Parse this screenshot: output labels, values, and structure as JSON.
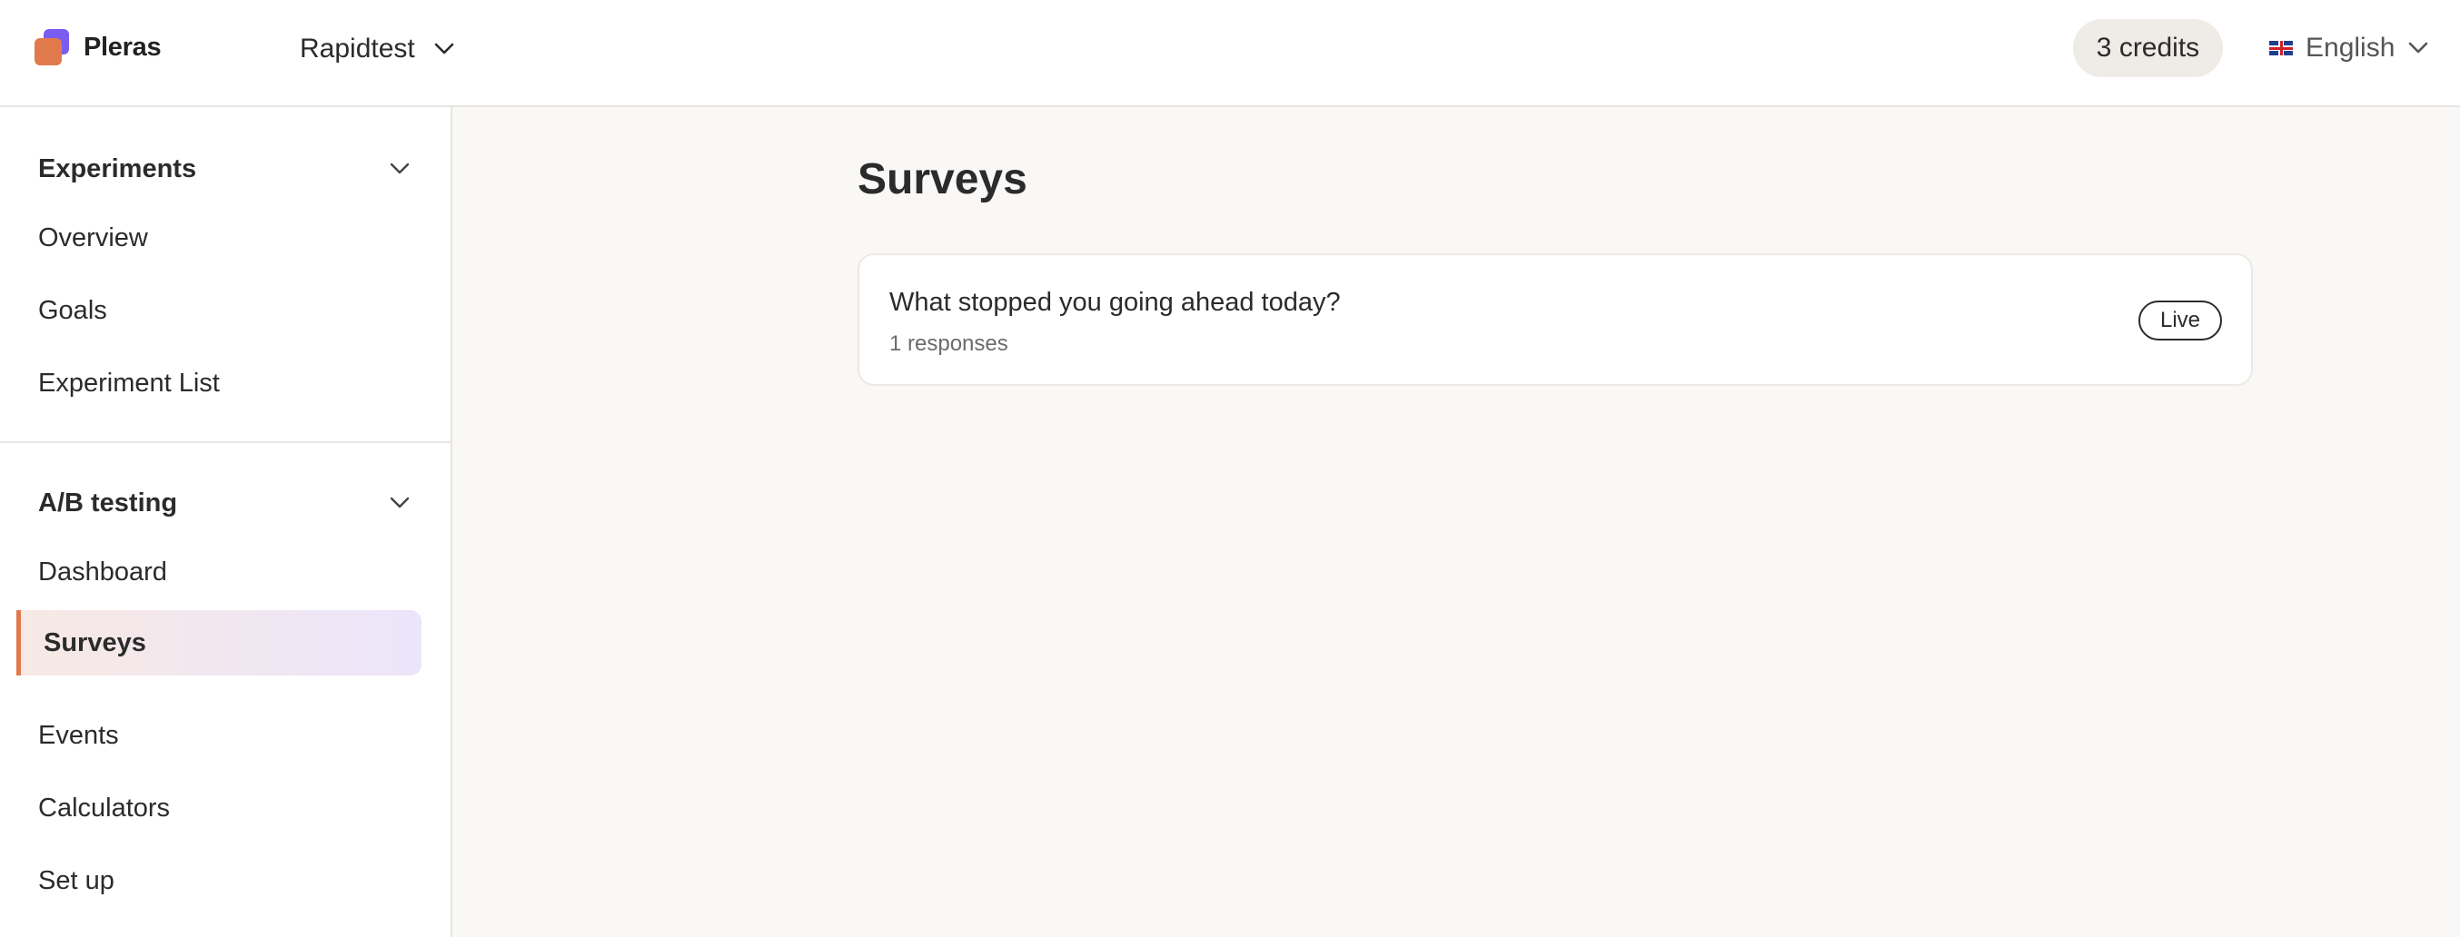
{
  "header": {
    "brand": "Pleras",
    "project": "Rapidtest",
    "credits": "3 credits",
    "language": "English",
    "logo_colors": {
      "back": "#7b5cf0",
      "front": "#e07a4c"
    }
  },
  "sidebar": {
    "sections": [
      {
        "title": "Experiments",
        "items": [
          "Overview",
          "Goals",
          "Experiment List"
        ]
      },
      {
        "title": "A/B testing",
        "items": [
          "Dashboard",
          "Surveys",
          "Events",
          "Calculators",
          "Set up"
        ],
        "active": "Surveys"
      }
    ],
    "accent_color": "#e07a4c"
  },
  "main": {
    "title": "Surveys",
    "surveys": [
      {
        "title": "What stopped you going ahead today?",
        "responses": "1 responses",
        "status": "Live"
      }
    ]
  }
}
